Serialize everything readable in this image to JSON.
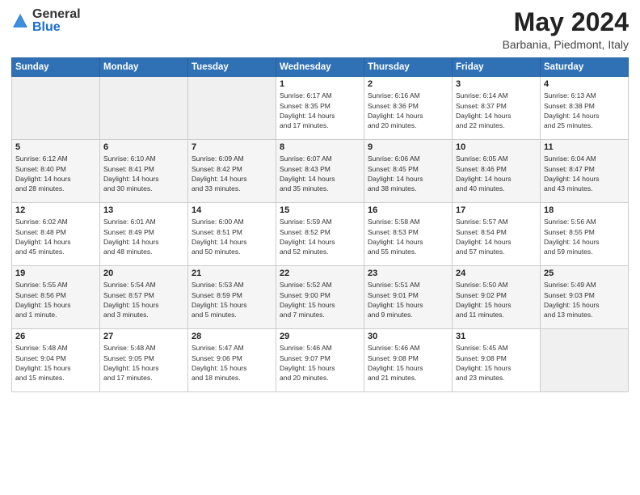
{
  "header": {
    "logo_general": "General",
    "logo_blue": "Blue",
    "title": "May 2024",
    "subtitle": "Barbania, Piedmont, Italy"
  },
  "columns": [
    "Sunday",
    "Monday",
    "Tuesday",
    "Wednesday",
    "Thursday",
    "Friday",
    "Saturday"
  ],
  "weeks": [
    [
      {
        "day": "",
        "info": ""
      },
      {
        "day": "",
        "info": ""
      },
      {
        "day": "",
        "info": ""
      },
      {
        "day": "1",
        "info": "Sunrise: 6:17 AM\nSunset: 8:35 PM\nDaylight: 14 hours\nand 17 minutes."
      },
      {
        "day": "2",
        "info": "Sunrise: 6:16 AM\nSunset: 8:36 PM\nDaylight: 14 hours\nand 20 minutes."
      },
      {
        "day": "3",
        "info": "Sunrise: 6:14 AM\nSunset: 8:37 PM\nDaylight: 14 hours\nand 22 minutes."
      },
      {
        "day": "4",
        "info": "Sunrise: 6:13 AM\nSunset: 8:38 PM\nDaylight: 14 hours\nand 25 minutes."
      }
    ],
    [
      {
        "day": "5",
        "info": "Sunrise: 6:12 AM\nSunset: 8:40 PM\nDaylight: 14 hours\nand 28 minutes."
      },
      {
        "day": "6",
        "info": "Sunrise: 6:10 AM\nSunset: 8:41 PM\nDaylight: 14 hours\nand 30 minutes."
      },
      {
        "day": "7",
        "info": "Sunrise: 6:09 AM\nSunset: 8:42 PM\nDaylight: 14 hours\nand 33 minutes."
      },
      {
        "day": "8",
        "info": "Sunrise: 6:07 AM\nSunset: 8:43 PM\nDaylight: 14 hours\nand 35 minutes."
      },
      {
        "day": "9",
        "info": "Sunrise: 6:06 AM\nSunset: 8:45 PM\nDaylight: 14 hours\nand 38 minutes."
      },
      {
        "day": "10",
        "info": "Sunrise: 6:05 AM\nSunset: 8:46 PM\nDaylight: 14 hours\nand 40 minutes."
      },
      {
        "day": "11",
        "info": "Sunrise: 6:04 AM\nSunset: 8:47 PM\nDaylight: 14 hours\nand 43 minutes."
      }
    ],
    [
      {
        "day": "12",
        "info": "Sunrise: 6:02 AM\nSunset: 8:48 PM\nDaylight: 14 hours\nand 45 minutes."
      },
      {
        "day": "13",
        "info": "Sunrise: 6:01 AM\nSunset: 8:49 PM\nDaylight: 14 hours\nand 48 minutes."
      },
      {
        "day": "14",
        "info": "Sunrise: 6:00 AM\nSunset: 8:51 PM\nDaylight: 14 hours\nand 50 minutes."
      },
      {
        "day": "15",
        "info": "Sunrise: 5:59 AM\nSunset: 8:52 PM\nDaylight: 14 hours\nand 52 minutes."
      },
      {
        "day": "16",
        "info": "Sunrise: 5:58 AM\nSunset: 8:53 PM\nDaylight: 14 hours\nand 55 minutes."
      },
      {
        "day": "17",
        "info": "Sunrise: 5:57 AM\nSunset: 8:54 PM\nDaylight: 14 hours\nand 57 minutes."
      },
      {
        "day": "18",
        "info": "Sunrise: 5:56 AM\nSunset: 8:55 PM\nDaylight: 14 hours\nand 59 minutes."
      }
    ],
    [
      {
        "day": "19",
        "info": "Sunrise: 5:55 AM\nSunset: 8:56 PM\nDaylight: 15 hours\nand 1 minute."
      },
      {
        "day": "20",
        "info": "Sunrise: 5:54 AM\nSunset: 8:57 PM\nDaylight: 15 hours\nand 3 minutes."
      },
      {
        "day": "21",
        "info": "Sunrise: 5:53 AM\nSunset: 8:59 PM\nDaylight: 15 hours\nand 5 minutes."
      },
      {
        "day": "22",
        "info": "Sunrise: 5:52 AM\nSunset: 9:00 PM\nDaylight: 15 hours\nand 7 minutes."
      },
      {
        "day": "23",
        "info": "Sunrise: 5:51 AM\nSunset: 9:01 PM\nDaylight: 15 hours\nand 9 minutes."
      },
      {
        "day": "24",
        "info": "Sunrise: 5:50 AM\nSunset: 9:02 PM\nDaylight: 15 hours\nand 11 minutes."
      },
      {
        "day": "25",
        "info": "Sunrise: 5:49 AM\nSunset: 9:03 PM\nDaylight: 15 hours\nand 13 minutes."
      }
    ],
    [
      {
        "day": "26",
        "info": "Sunrise: 5:48 AM\nSunset: 9:04 PM\nDaylight: 15 hours\nand 15 minutes."
      },
      {
        "day": "27",
        "info": "Sunrise: 5:48 AM\nSunset: 9:05 PM\nDaylight: 15 hours\nand 17 minutes."
      },
      {
        "day": "28",
        "info": "Sunrise: 5:47 AM\nSunset: 9:06 PM\nDaylight: 15 hours\nand 18 minutes."
      },
      {
        "day": "29",
        "info": "Sunrise: 5:46 AM\nSunset: 9:07 PM\nDaylight: 15 hours\nand 20 minutes."
      },
      {
        "day": "30",
        "info": "Sunrise: 5:46 AM\nSunset: 9:08 PM\nDaylight: 15 hours\nand 21 minutes."
      },
      {
        "day": "31",
        "info": "Sunrise: 5:45 AM\nSunset: 9:08 PM\nDaylight: 15 hours\nand 23 minutes."
      },
      {
        "day": "",
        "info": ""
      }
    ]
  ]
}
